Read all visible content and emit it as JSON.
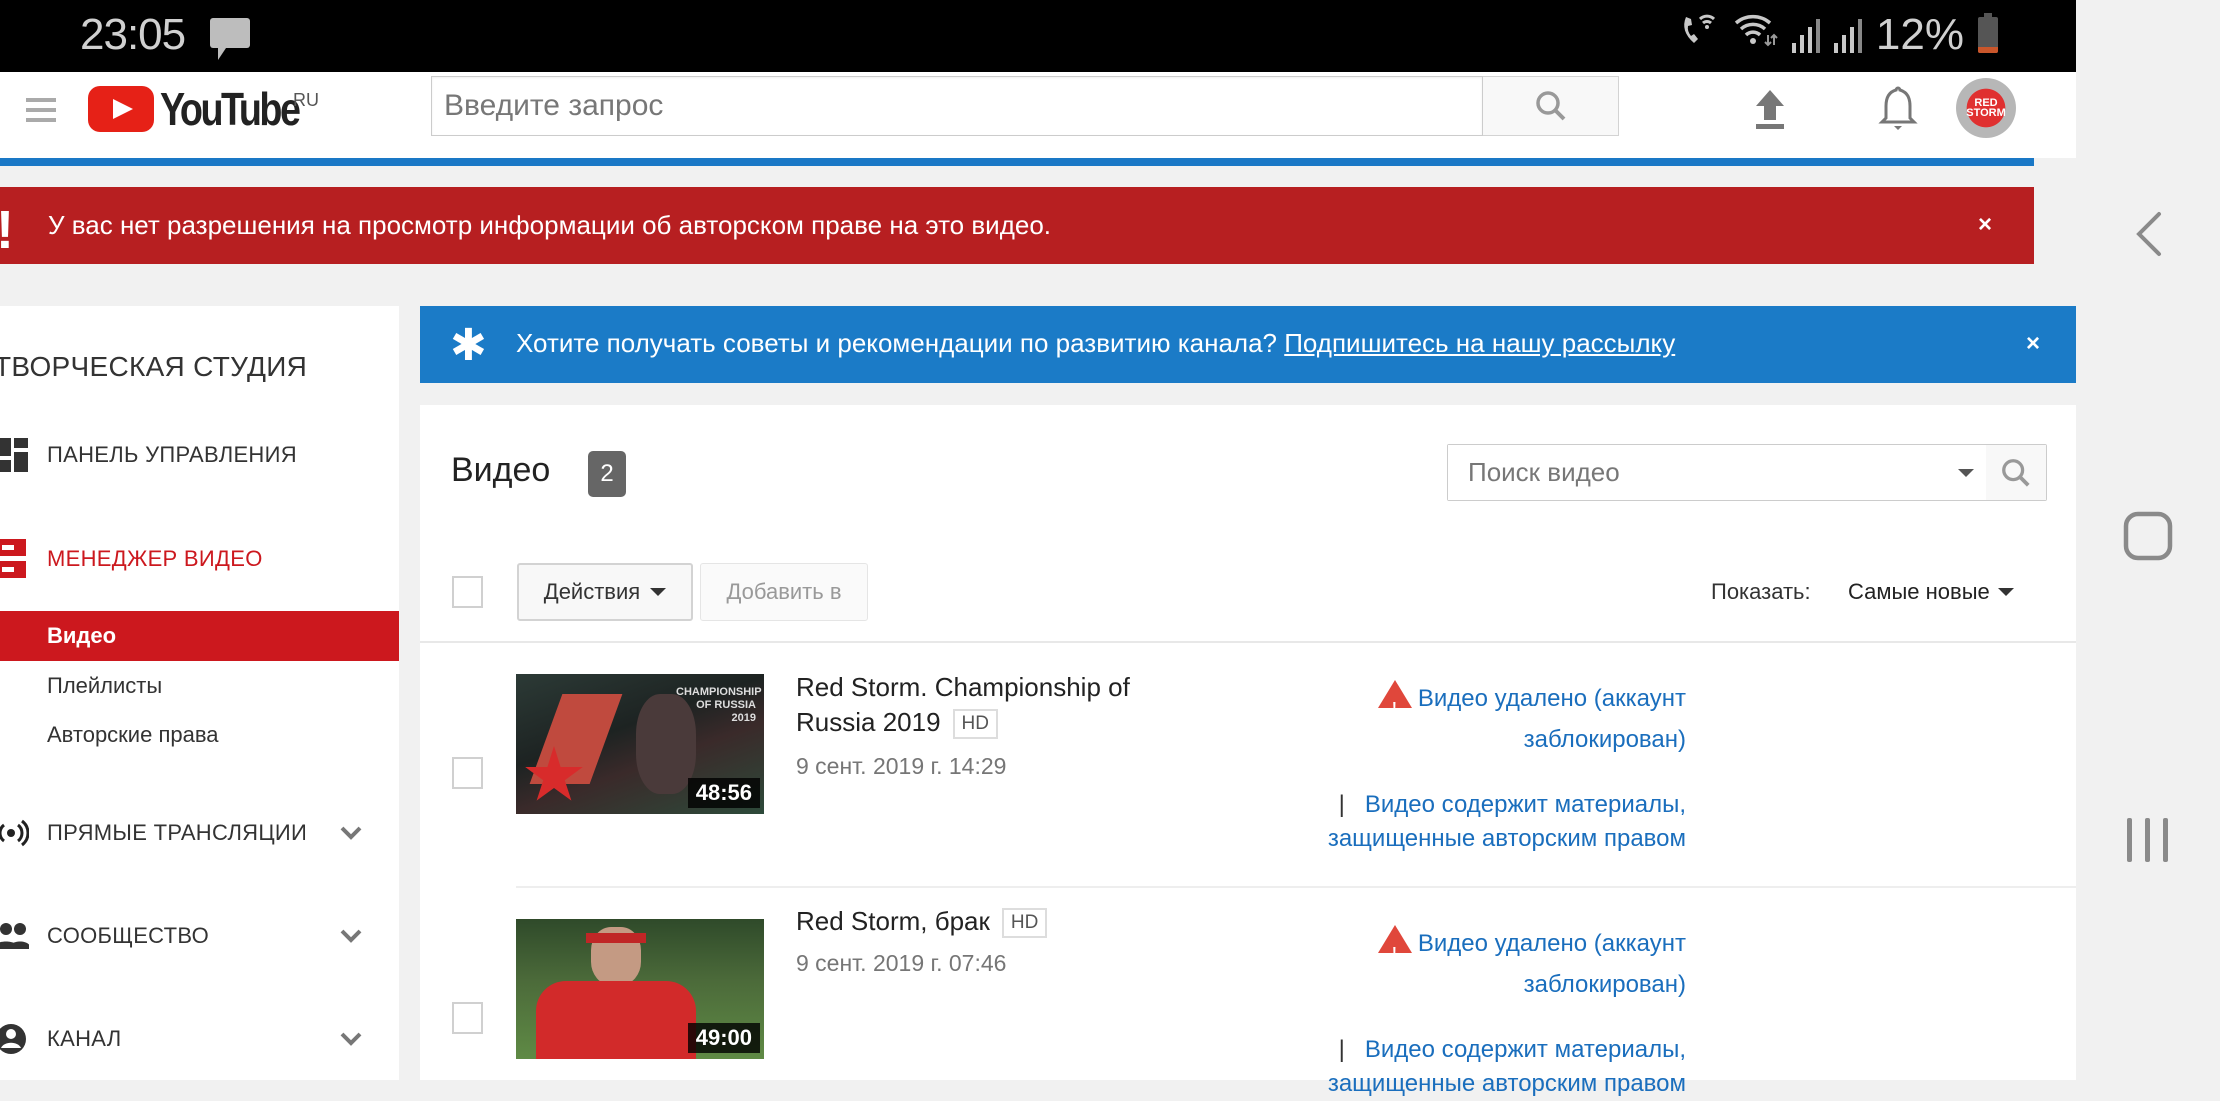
{
  "status_bar": {
    "time": "23:05",
    "battery": "12%",
    "icons": [
      "message-icon",
      "wifi-call-icon",
      "wifi-icon",
      "signal-icon",
      "signal-icon",
      "battery-icon"
    ]
  },
  "header": {
    "logo_text": "YouTube",
    "logo_region": "RU",
    "search_placeholder": "Введите запрос",
    "icons": [
      "menu-icon",
      "search-icon",
      "upload-icon",
      "bell-icon",
      "avatar"
    ],
    "avatar_text": "RED STORM"
  },
  "error_banner": {
    "icon": "!",
    "text": "У вас нет разрешения на просмотр информации об авторском праве на это видео.",
    "close": "×"
  },
  "tip_banner": {
    "icon": "✱",
    "text": "Хотите получать советы и рекомендации по развитию канала? ",
    "link": "Подпишитесь на нашу рассылку",
    "close": "×"
  },
  "sidebar": {
    "title": "ТВОРЧЕСКАЯ СТУДИЯ",
    "items": [
      {
        "label": "ПАНЕЛЬ УПРАВЛЕНИЯ",
        "icon": "dashboard-icon"
      },
      {
        "label": "МЕНЕДЖЕР ВИДЕО",
        "icon": "video-manager-icon",
        "active": true
      },
      {
        "label": "ПРЯМЫЕ ТРАНСЛЯЦИИ",
        "icon": "live-icon",
        "expandable": true
      },
      {
        "label": "СООБЩЕСТВО",
        "icon": "community-icon",
        "expandable": true
      },
      {
        "label": "КАНАЛ",
        "icon": "channel-icon",
        "expandable": true
      }
    ],
    "subitems": [
      {
        "label": "Видео",
        "active": true
      },
      {
        "label": "Плейлисты"
      },
      {
        "label": "Авторские права"
      }
    ]
  },
  "main": {
    "title": "Видео",
    "count": "2",
    "search_placeholder": "Поиск видео",
    "actions_label": "Действия",
    "add_to_label": "Добавить в",
    "show_label": "Показать:",
    "sort_value": "Самые новые",
    "videos": [
      {
        "title": "Red Storm. Championship of Russia 2019",
        "quality": "HD",
        "date": "9 сент. 2019 г. 14:29",
        "duration": "48:56",
        "status": "Видео удалено (аккаунт заблокирован)",
        "claim": "Видео содержит материалы, защищенные авторским правом",
        "thumb_overlay": "CHAMPIONSHIP OF RUSSIA 2019"
      },
      {
        "title": "Red Storm, брак",
        "quality": "HD",
        "date": "9 сент. 2019 г. 07:46",
        "duration": "49:00",
        "status": "Видео удалено (аккаунт заблокирован)",
        "claim": "Видео содержит материалы, защищенные авторским правом"
      }
    ]
  },
  "colors": {
    "error_red": "#b71f21",
    "active_red": "#cc181e",
    "info_blue": "#1b7bc7",
    "link_blue": "#1a6ebd",
    "warn_red": "#e0473b"
  }
}
